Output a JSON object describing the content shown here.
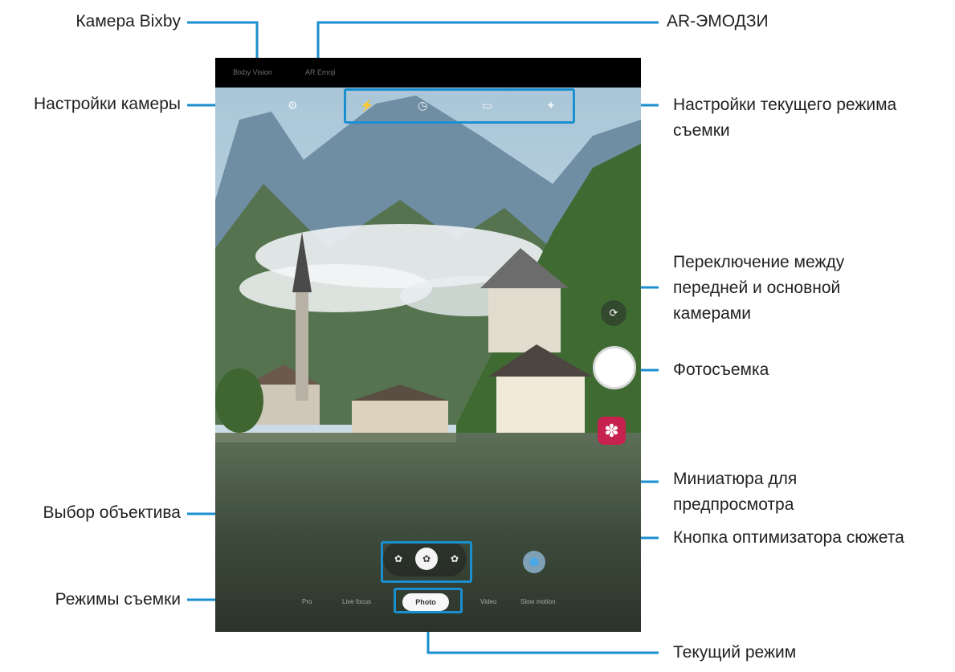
{
  "callouts": {
    "bixby_camera": "Камера Bixby",
    "ar_emoji": "AR-ЭМОДЗИ",
    "camera_settings": "Настройки камеры",
    "current_mode_settings_1": "Настройки текущего режима",
    "current_mode_settings_2": "съемки",
    "switch_camera_1": "Переключение между",
    "switch_camera_2": "передней и основной",
    "switch_camera_3": "камерами",
    "take_photo": "Фотосъемка",
    "preview_thumbnail_1": "Миниатюра для",
    "preview_thumbnail_2": "предпросмотра",
    "lens_selection": "Выбор объектива",
    "scene_optimizer": "Кнопка оптимизатора сюжета",
    "shooting_modes": "Режимы съемки",
    "current_mode": "Текущий режим"
  },
  "screen": {
    "topbar": {
      "bixby_vision": "Bixby Vision",
      "ar_emoji": "AR Emoji"
    },
    "quick_settings_icons": [
      "settings-icon",
      "flash-icon",
      "timer-icon",
      "ratio-icon",
      "filter-icon"
    ],
    "modes": [
      "Pro",
      "Live focus",
      "Photo",
      "Video",
      "Slow motion"
    ],
    "selected_mode": "Photo",
    "zoom_glyphs": [
      "✿",
      "✿",
      "✿"
    ],
    "switch_glyph": "⟳",
    "thumbnail_glyph": "✽"
  },
  "colors": {
    "accent": "#1a8fd0",
    "thumbnail": "#c7224f",
    "topbar": "#000000"
  }
}
